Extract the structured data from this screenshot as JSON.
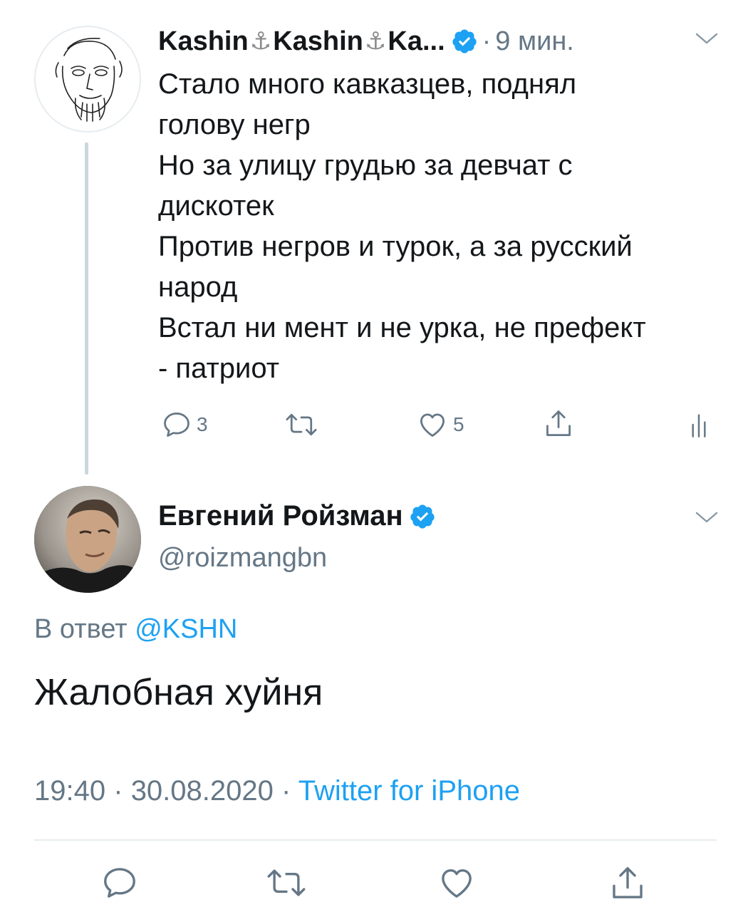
{
  "tweet1": {
    "name": "Kashin",
    "name_2": "Kashin",
    "name_3": "Ka...",
    "anchor": "⚓",
    "dot": "·",
    "time": "9 мин.",
    "lines": [
      "Стало много кавказцев, поднял",
      "голову негр",
      "Но за улицу грудью за девчат с",
      "дискотек",
      "Против негров и турок, а за русский",
      "народ",
      "Встал ни мент и не урка, не префект",
      "- патриот"
    ],
    "replies": "3",
    "likes": "5"
  },
  "tweet2": {
    "name": "Евгений Ройзман",
    "handle": "@roizmangbn",
    "reply_prefix": "В ответ",
    "reply_handle": "@KSHN",
    "text": "Жалобная хуйня",
    "time": "19:40",
    "sep1": "·",
    "date": "30.08.2020",
    "sep2": "·",
    "source": "Twitter for iPhone"
  },
  "colors": {
    "accent": "#1da1f2",
    "muted": "#657786",
    "text": "#14171a",
    "divider": "#e6ecf0"
  },
  "icons": [
    "reply-icon",
    "retweet-icon",
    "like-icon",
    "share-icon",
    "stats-icon",
    "verified-icon",
    "chevron-down-icon"
  ]
}
